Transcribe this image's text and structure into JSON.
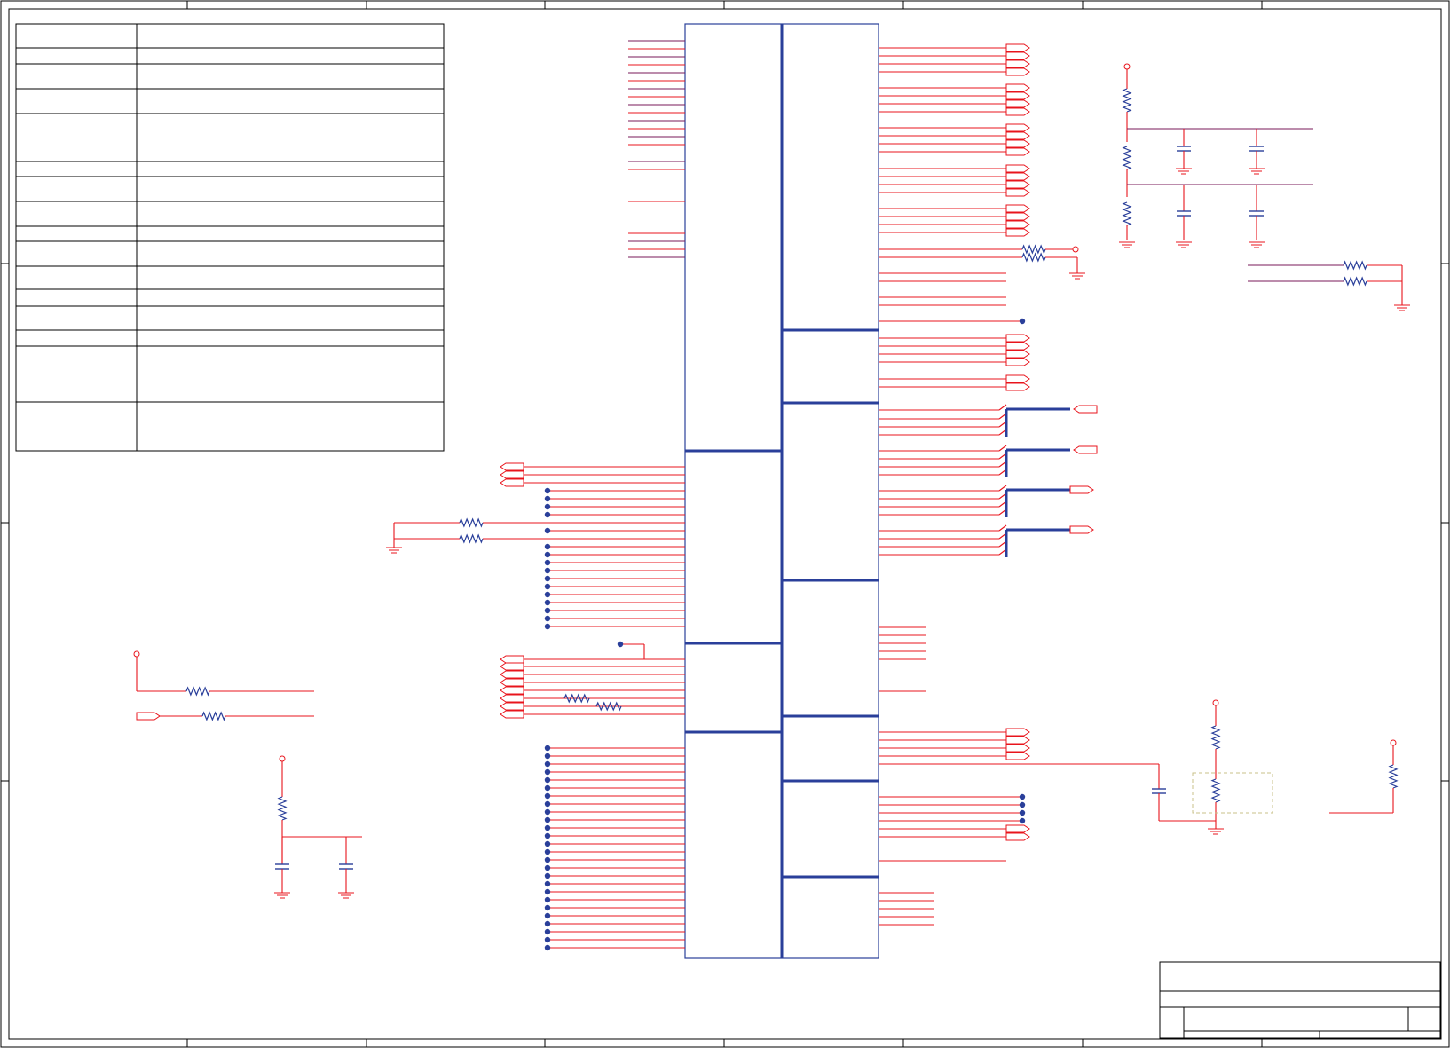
{
  "diagram": {
    "kind": "electrical-schematic-sheet",
    "colors": {
      "signal_wire": "#e8141c",
      "component_body": "#2a3f9a",
      "junction": "#2a3f9a",
      "border": "#000000",
      "background": "#ffffff"
    },
    "note": "",
    "revision_table": {
      "rows": 17
    },
    "title_block": {
      "title": "",
      "sheet": ""
    }
  }
}
